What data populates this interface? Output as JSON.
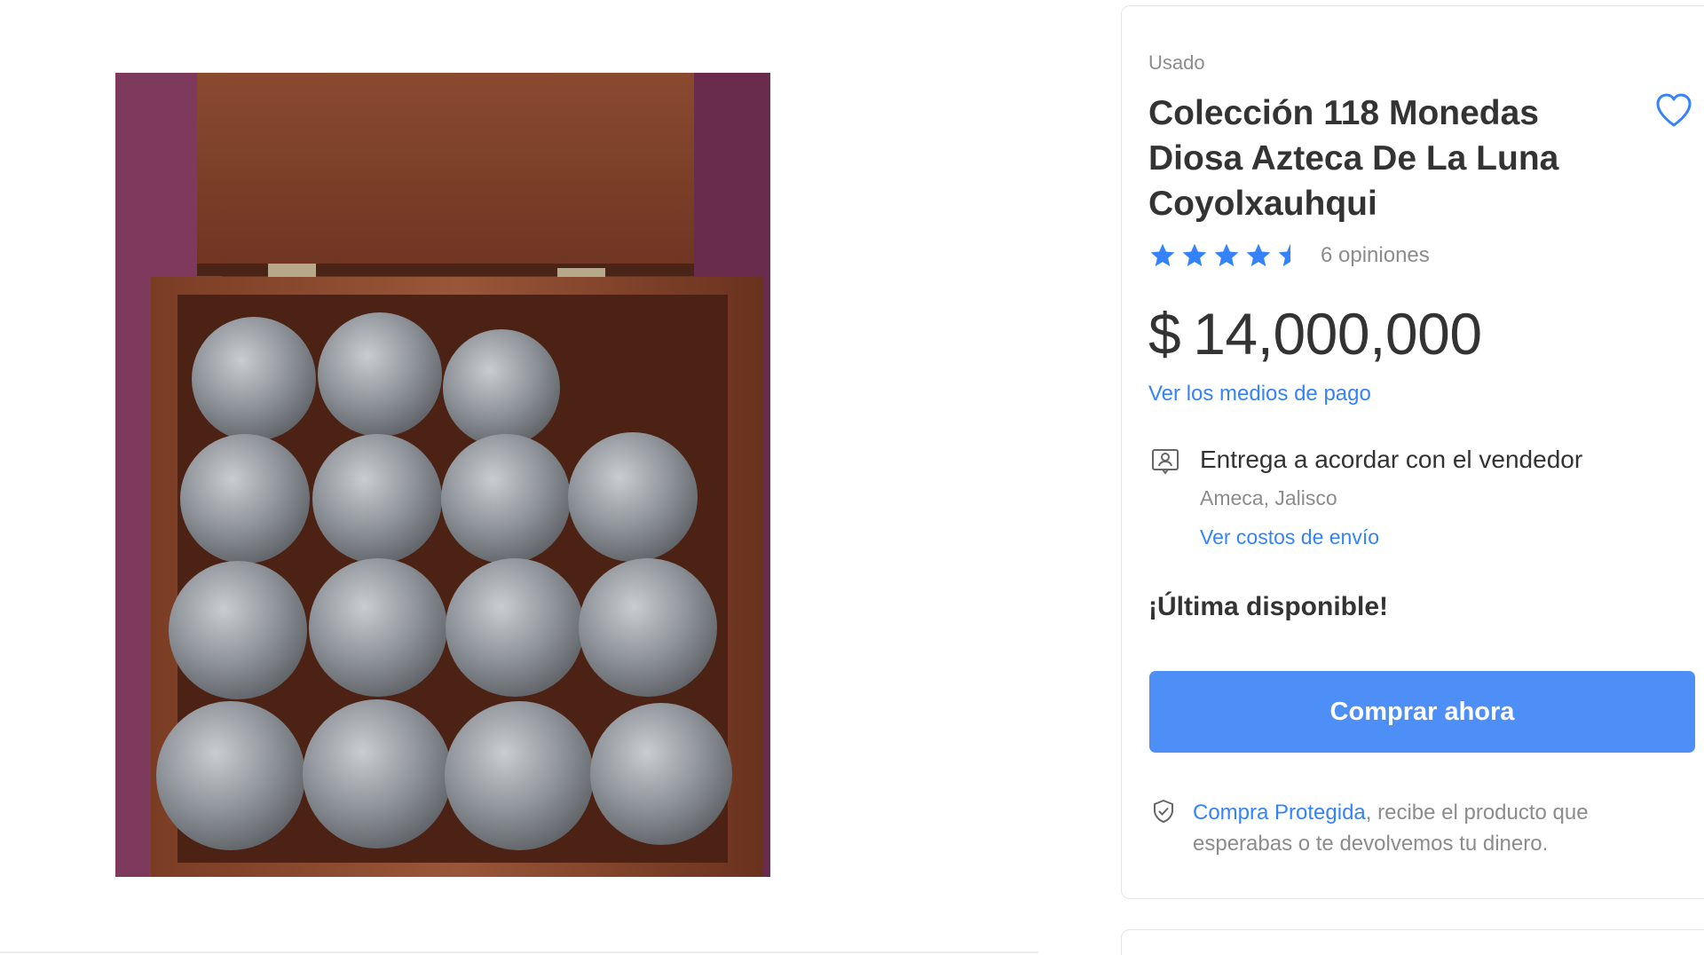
{
  "product": {
    "image_alt": "Caja de madera con pilas de monedas",
    "condition": "Usado",
    "title": "Colección 118 Monedas Diosa Azteca De La Luna Coyolxauhqui",
    "rating": 4.5,
    "rating_max": 5,
    "reviews_label": "6 opiniones",
    "price_currency": "$",
    "price_value": "14,000,000",
    "payment_link": "Ver los medios de pago"
  },
  "delivery": {
    "title": "Entrega a acordar con el vendedor",
    "location": "Ameca, Jalisco",
    "shipping_link": "Ver costos de envío"
  },
  "stock_label": "¡Última disponible!",
  "buy_button_label": "Comprar ahora",
  "protection": {
    "link": "Compra Protegida",
    "text": ", recibe el producto que esperabas o te devolvemos tu dinero."
  },
  "colors": {
    "accent": "#3483fa",
    "button": "#4e8ff7",
    "star": "#3483fa",
    "text": "#333333",
    "muted": "#8c8c8c"
  },
  "icons": {
    "favorite": "heart-outline-icon",
    "rating": "star-icon",
    "delivery": "person-card-icon",
    "protection": "shield-check-icon"
  }
}
